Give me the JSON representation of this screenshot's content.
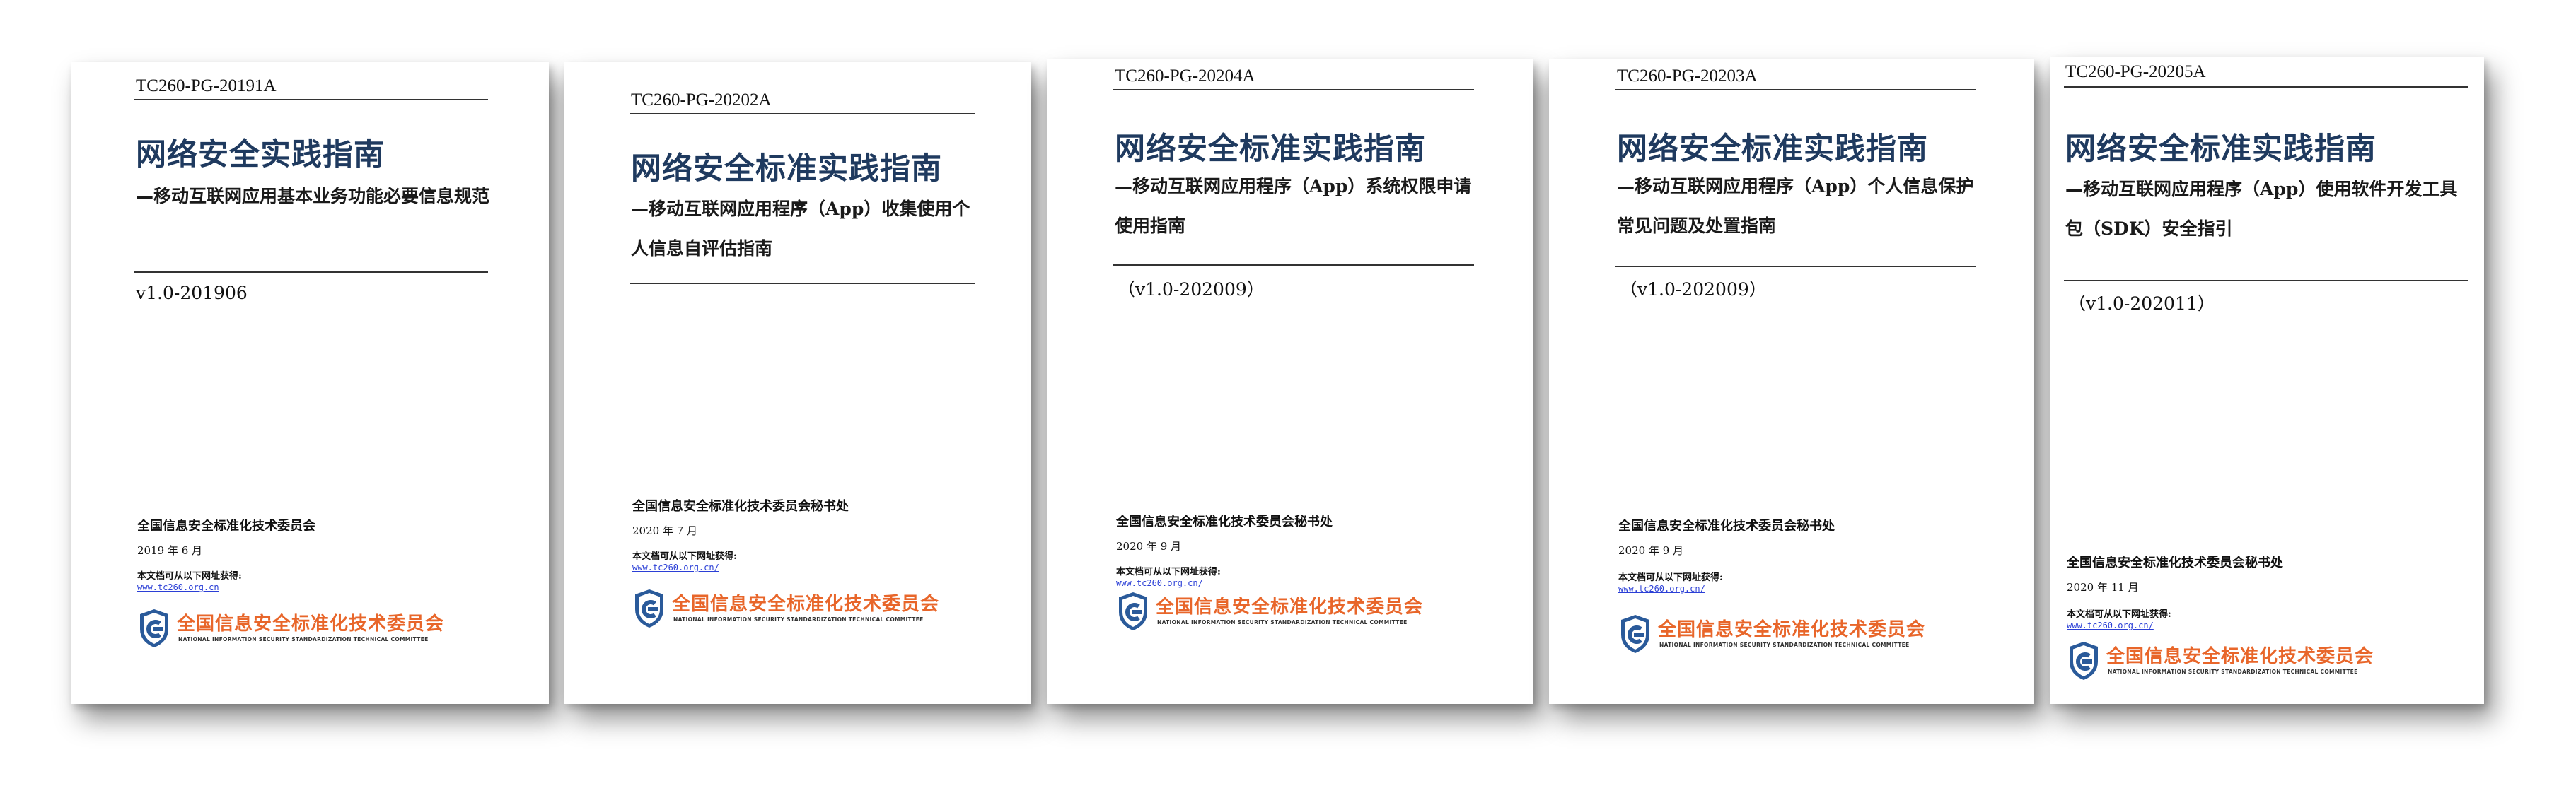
{
  "covers": [
    {
      "doc_id": "TC260-PG-20191A",
      "main_title": "网络安全实践指南",
      "sub_title": "—移动互联网应用基本业务功能必要信息规范",
      "version": "v1.0-201906",
      "org": "全国信息安全标准化技术委员会",
      "date": "2019 年 6 月",
      "availability": "本文档可从以下网址获得:",
      "url": "www.tc260.org.cn"
    },
    {
      "doc_id": "TC260-PG-20202A",
      "main_title": "网络安全标准实践指南",
      "sub_title": "—移动互联网应用程序（App）收集使用个人信息自评估指南",
      "version": "",
      "org": "全国信息安全标准化技术委员会秘书处",
      "date": "2020 年 7 月",
      "availability": "本文档可从以下网址获得:",
      "url": "www.tc260.org.cn/"
    },
    {
      "doc_id": "TC260-PG-20204A",
      "main_title": "网络安全标准实践指南",
      "sub_title": "—移动互联网应用程序（App）系统权限申请使用指南",
      "version": "（v1.0-202009）",
      "org": "全国信息安全标准化技术委员会秘书处",
      "date": "2020 年 9 月",
      "availability": "本文档可从以下网址获得:",
      "url": "www.tc260.org.cn/"
    },
    {
      "doc_id": "TC260-PG-20203A",
      "main_title": "网络安全标准实践指南",
      "sub_title": "—移动互联网应用程序（App）个人信息保护常见问题及处置指南",
      "version": "（v1.0-202009）",
      "org": "全国信息安全标准化技术委员会秘书处",
      "date": "2020 年 9 月",
      "availability": "本文档可从以下网址获得:",
      "url": "www.tc260.org.cn/"
    },
    {
      "doc_id": "TC260-PG-20205A",
      "main_title": "网络安全标准实践指南",
      "sub_title": "—移动互联网应用程序（App）使用软件开发工具包（SDK）安全指引",
      "version": "（v1.0-202011）",
      "org": "全国信息安全标准化技术委员会秘书处",
      "date": "2020 年 11 月",
      "availability": "本文档可从以下网址获得:",
      "url": "www.tc260.org.cn/"
    }
  ],
  "logo": {
    "name_cn": "全国信息安全标准化技术委员会",
    "name_en": "NATIONAL INFORMATION SECURITY STANDARDIZATION TECHNICAL COMMITTEE",
    "icon": "tc260-shield-emblem-icon",
    "color_cn": "#e8662a",
    "color_emblem": "#2a5a9a"
  },
  "colors": {
    "title_navy": "#1f3a5f",
    "link_blue": "#2b3fd6"
  }
}
